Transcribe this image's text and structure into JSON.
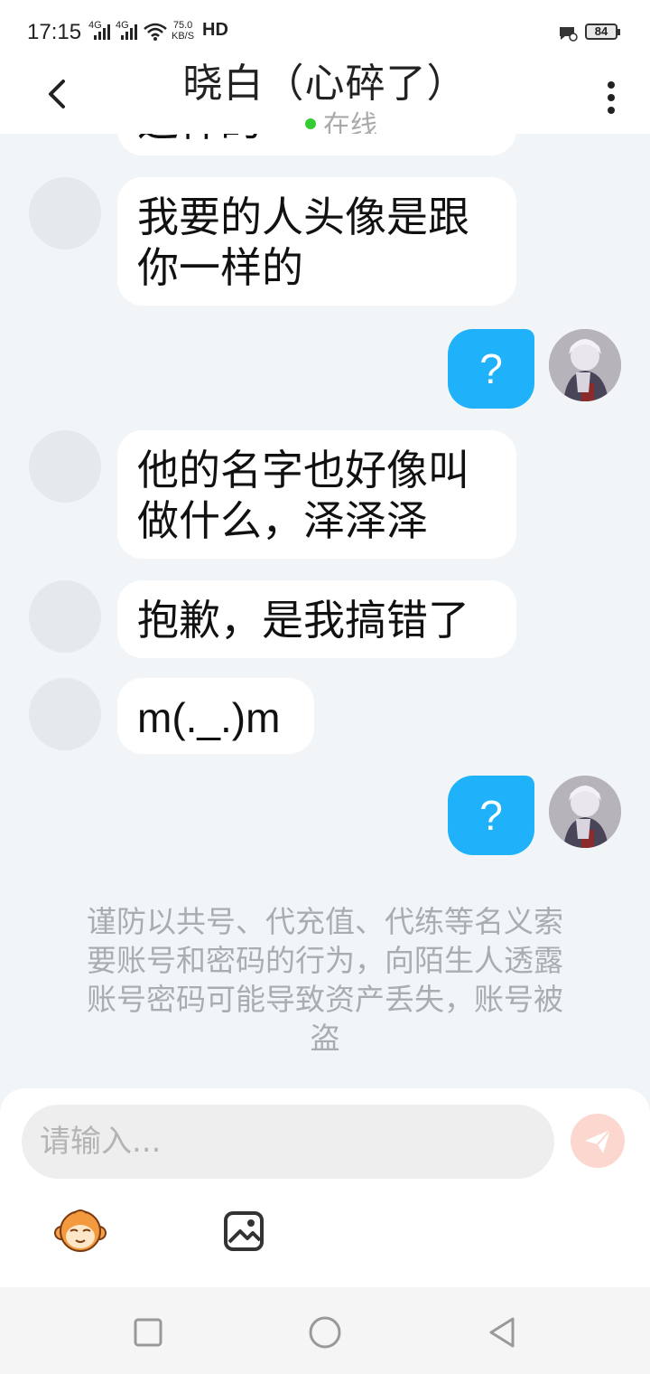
{
  "status_bar": {
    "time": "17:15",
    "net1": "4G",
    "net2": "4G",
    "speed_value": "75.0",
    "speed_unit": "KB/S",
    "hd": "HD",
    "battery": "84"
  },
  "header": {
    "title": "晓白（心碎了）",
    "status": "在线",
    "status_color": "#33cc33"
  },
  "messages": [
    {
      "side": "left",
      "text": "这样的",
      "partial": true
    },
    {
      "side": "left",
      "lines": [
        "我要的人头像是跟",
        "你一样的"
      ]
    },
    {
      "side": "right",
      "text": "?"
    },
    {
      "side": "left",
      "lines": [
        "他的名字也好像叫",
        "做什么，泽泽泽"
      ]
    },
    {
      "side": "left",
      "text": "抱歉，是我搞错了"
    },
    {
      "side": "left",
      "text": "m(._.)m"
    },
    {
      "side": "right",
      "text": "?"
    }
  ],
  "notice": {
    "lines": [
      "谨防以共号、代充值、代练等名义索",
      "要账号和密码的行为，向陌生人透露",
      "账号密码可能导致资产丢失，账号被",
      "盗"
    ]
  },
  "input": {
    "placeholder": "请输入...",
    "value": ""
  },
  "toolbar": {
    "emoji_icon": "monkey-emoji-icon",
    "image_icon": "image-icon"
  },
  "colors": {
    "bubble_right": "#1fb2fb",
    "send_button": "#fbd7cf"
  }
}
